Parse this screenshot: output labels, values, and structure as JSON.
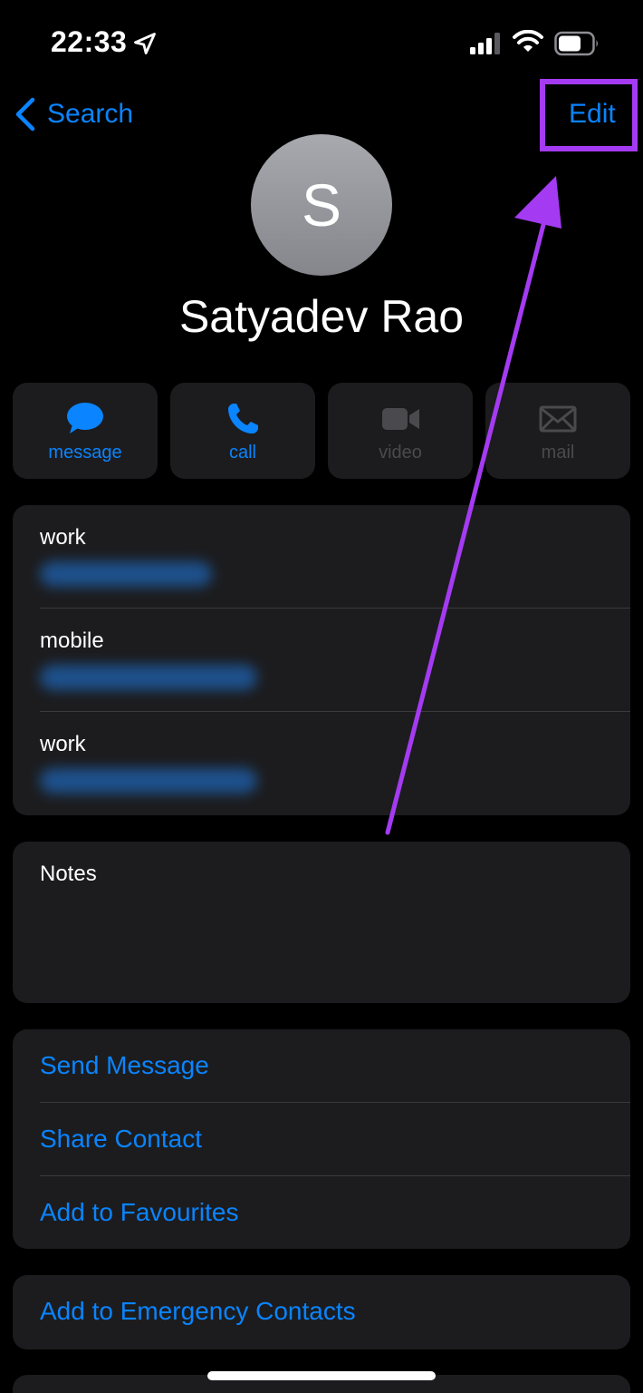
{
  "status_bar": {
    "time": "22:33",
    "location_icon": "location-arrow-icon",
    "signal_icon": "cellular-signal-icon",
    "wifi_icon": "wifi-icon",
    "battery_icon": "battery-icon"
  },
  "nav": {
    "back_label": "Search",
    "back_icon": "chevron-left-icon",
    "edit_label": "Edit"
  },
  "contact": {
    "initial": "S",
    "name": "Satyadev Rao"
  },
  "actions": [
    {
      "label": "message",
      "icon": "message-bubble-icon",
      "enabled": true
    },
    {
      "label": "call",
      "icon": "phone-icon",
      "enabled": true
    },
    {
      "label": "video",
      "icon": "video-camera-icon",
      "enabled": false
    },
    {
      "label": "mail",
      "icon": "envelope-icon",
      "enabled": false
    }
  ],
  "phones": [
    {
      "label": "work"
    },
    {
      "label": "mobile"
    },
    {
      "label": "work"
    }
  ],
  "notes": {
    "label": "Notes"
  },
  "links": {
    "send_message": "Send Message",
    "share_contact": "Share Contact",
    "add_favourites": "Add to Favourites"
  },
  "emergency": {
    "label": "Add to Emergency Contacts"
  },
  "colors": {
    "accent": "#0a84ff",
    "annotation": "#a43bf2",
    "card": "#1c1c1e",
    "disabled": "#4a4a4e"
  }
}
